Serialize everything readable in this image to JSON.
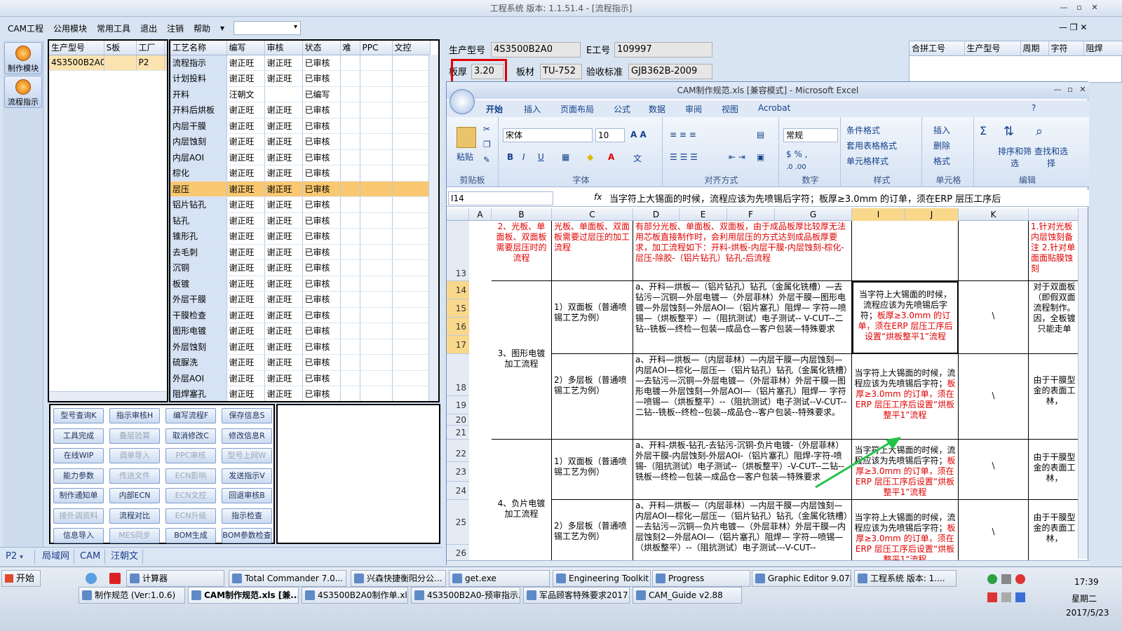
{
  "window": {
    "title": "工程系统  版本: 1.1.51.4 - [流程指示]"
  },
  "menu": {
    "items": [
      "CAM工程",
      "公用模块",
      "常用工具",
      "退出",
      "注销",
      "帮助"
    ]
  },
  "leftbar": {
    "buttons": [
      "制作模块",
      "流程指示"
    ]
  },
  "product_grid": {
    "headers": [
      "生产型号",
      "S板",
      "工厂"
    ],
    "rows": [
      [
        "4S3500B2A0",
        "",
        "P2"
      ]
    ]
  },
  "process_grid": {
    "headers": [
      "工艺名称",
      "编写",
      "审核",
      "状态",
      "难",
      "PPC",
      "文控"
    ],
    "rows": [
      [
        "流程指示",
        "谢正旺",
        "谢正旺",
        "已审核"
      ],
      [
        "计划投料",
        "谢正旺",
        "谢正旺",
        "已审核"
      ],
      [
        "开料",
        "汪朝文",
        "",
        "已编写"
      ],
      [
        "开料后烘板",
        "谢正旺",
        "谢正旺",
        "已审核"
      ],
      [
        "内层干膜",
        "谢正旺",
        "谢正旺",
        "已审核"
      ],
      [
        "内层蚀刻",
        "谢正旺",
        "谢正旺",
        "已审核"
      ],
      [
        "内层AOI",
        "谢正旺",
        "谢正旺",
        "已审核"
      ],
      [
        "棕化",
        "谢正旺",
        "谢正旺",
        "已审核"
      ],
      [
        "层压",
        "谢正旺",
        "谢正旺",
        "已审核"
      ],
      [
        "铝片钻孔",
        "谢正旺",
        "谢正旺",
        "已审核"
      ],
      [
        "钻孔",
        "谢正旺",
        "谢正旺",
        "已审核"
      ],
      [
        "锥形孔",
        "谢正旺",
        "谢正旺",
        "已审核"
      ],
      [
        "去毛刺",
        "谢正旺",
        "谢正旺",
        "已审核"
      ],
      [
        "沉铜",
        "谢正旺",
        "谢正旺",
        "已审核"
      ],
      [
        "板镀",
        "谢正旺",
        "谢正旺",
        "已审核"
      ],
      [
        "外层干膜",
        "谢正旺",
        "谢正旺",
        "已审核"
      ],
      [
        "干膜检查",
        "谢正旺",
        "谢正旺",
        "已审核"
      ],
      [
        "图形电镀",
        "谢正旺",
        "谢正旺",
        "已审核"
      ],
      [
        "外层蚀刻",
        "谢正旺",
        "谢正旺",
        "已审核"
      ],
      [
        "硫脲洗",
        "谢正旺",
        "谢正旺",
        "已审核"
      ],
      [
        "外层AOI",
        "谢正旺",
        "谢正旺",
        "已审核"
      ],
      [
        "阻焊塞孔",
        "谢正旺",
        "谢正旺",
        "已审核"
      ]
    ]
  },
  "buttons": [
    [
      "型号查询K",
      "指示审核H",
      "编写流程F",
      "保存信息S"
    ],
    [
      "工具完成",
      "叠层验算",
      "取消修改C",
      "修改信息R"
    ],
    [
      "在线WIP",
      "调单导入",
      "PPC审核",
      "型号上网W"
    ],
    [
      "能力参数",
      "传送文件",
      "ECN影响",
      "发送指示V"
    ],
    [
      "制作通知单",
      "内部ECN",
      "ECN文控",
      "回退审核B"
    ],
    [
      "接外调资料",
      "流程对比",
      "ECN升级",
      "指示检查"
    ],
    [
      "信息导入",
      "MES同步",
      "BOM生成",
      "BOM参数检查"
    ]
  ],
  "status_tabs": [
    "P2",
    "局域网",
    "CAM",
    "汪朝文"
  ],
  "info": {
    "product_label": "生产型号",
    "product_value": "4S3500B2A0",
    "e_label": "E工号",
    "e_value": "109997",
    "thick_label": "板厚",
    "thick_value": "3.20",
    "mat_label": "板材",
    "mat_value": "TU-752",
    "std_label": "验收标准",
    "std_value": "GJB362B-2009"
  },
  "right_grid": {
    "headers": [
      "合拼工号",
      "生产型号",
      "周期",
      "字符",
      "阻焊"
    ]
  },
  "excel": {
    "title": "CAM制作规范.xls  [兼容模式] - Microsoft Excel",
    "tabs": [
      "开始",
      "插入",
      "页面布局",
      "公式",
      "数据",
      "审阅",
      "视图",
      "Acrobat"
    ],
    "groups": [
      "剪贴板",
      "字体",
      "对齐方式",
      "数字",
      "样式",
      "单元格",
      "编辑"
    ],
    "font_name": "宋体",
    "font_size": "10",
    "number_format": "常规",
    "paste": "粘贴",
    "styles": [
      "条件格式",
      "套用表格格式",
      "单元格样式"
    ],
    "cells_btns": [
      "插入",
      "删除",
      "格式"
    ],
    "edit_btns": [
      "排序和筛选",
      "查找和选择"
    ],
    "name_box": "I14",
    "formula": "当字符上大锡面的时候，流程应该为先喷锡后字符；板厚≥3.0mm 的订单，须在ERP 层压工序后",
    "columns": [
      "A",
      "B",
      "C",
      "D",
      "E",
      "F",
      "G",
      "I",
      "J",
      "K"
    ],
    "rows": [
      "13",
      "14",
      "15",
      "16",
      "17",
      "18",
      "19",
      "20",
      "21",
      "22",
      "23",
      "24",
      "25",
      "26"
    ],
    "r13_b": "2、光板、单面板、双面板需要层压时的流程",
    "r13_c": "光板、单面板、双面板需要过层压的加工流程",
    "r13_d": "有部分光板、单面板、双面板，由于成品板厚比较厚无法用芯板直接制作时，会利用层压的方式达到成品板厚要求，加工流程如下：开料-烘板-内层干膜-内层蚀刻-棕化-层压-除胶-（铝片钻孔）钻孔-后流程",
    "r13_k": "1.针对光板内层蚀刻备注 2.针对单面面贴膜蚀刻",
    "b_graph": "3、图形电镀加工流程",
    "b_neg": "4、负片电镀加工流程",
    "c_double": "1）双面板（普通喷锡工艺为例）",
    "c_multi": "2）多层板（普通喷锡工艺为例）",
    "d1": "a、开料—烘板—（铝片钻孔）钻孔（金属化铣槽）—去钻污—沉铜—外层电镀—（外层菲林）外层干膜—图形电镀—外层蚀刻—外层AOI—（铝片塞孔）阻焊— 字符—喷锡—（烘板整平）—（阻抗测试）电子测试-- V-CUT--二钻--铣板—终检—包装—成品仓—客户包装—特殊要求",
    "d2": "a、开料—烘板—（内层菲林）—内层干膜—内层蚀刻—内层AOI—棕化—层压—（铝片钻孔）钻孔（金属化铣槽）—去钻污—沉铜—外层电镀—（外层菲林）外层干膜—图形电镀—外层蚀刻—外层AOI—（铝片塞孔）阻焊— 字符—喷锡—（烘板整平）--（阻抗测试）电子测试--V-CUT--二钻--铣板--终检--包装--成品仓--客户包装--特殊要求。",
    "d3": "a、开料-烘板-钻孔-去钻污-沉铜-负片电镀-（外层菲林）外层干膜-内层蚀刻-外层AOI-（铝片塞孔）阻焊-字符-喷锡-（阻抗测试）电子测试--（烘板整平）-V-CUT--二钻--铣板—终检—包装—成品仓—客户包装—特殊要求",
    "d4": "a、开料—烘板—（内层菲林）—内层干膜—内层蚀刻—内层AOI—棕化—层压—（铝片钻孔）钻孔（金属化铣槽）—去钻污—沉铜—负片电镀—（外层菲林）外层干膜—内层蚀刻2—外层AOI—（铝片塞孔）阻焊— 字符—喷锡—（烘板整平）--（阻抗测试）电子测试---V-CUT--",
    "i_note_a": "当字符上大锡面的时候，流程应该为先喷锡后字符；",
    "i_note_b": "板厚≥3.0mm 的订单，须在ERP 层压工序后设置“烘板整平1”流程",
    "j_bs": "\\",
    "k14": "对于双面板（即假双面流程制作。因，全板镀只能走单",
    "k18": "由于干膜型金的表面工林，",
    "k22": "由于干膜型金的表面工林，",
    "k25": "由于干膜型金的表面工林，"
  },
  "taskbar": {
    "start": "开始",
    "row1": [
      "计算器",
      "Total Commander 7.0...",
      "兴森快捷衡阳分公...",
      "get.exe",
      "Engineering Toolkit 9....",
      "Progress",
      "Graphic Editor 9.07b2...",
      "工程系统  版本: 1...."
    ],
    "row2": [
      "制作规范 (Ver:1.0.6)",
      "CAM制作规范.xls [兼...",
      "4S3500B2A0制作单.xls ...",
      "4S3500B2A0-预审指示....",
      "军品顾客特殊要求2017...",
      "CAM_Guide v2.88"
    ],
    "time": "17:39",
    "weekday": "星期二",
    "date": "2017/5/23"
  },
  "colors": {
    "accent": "#f9c870",
    "red": "#e00000",
    "green_arrow": "#22c34a"
  }
}
